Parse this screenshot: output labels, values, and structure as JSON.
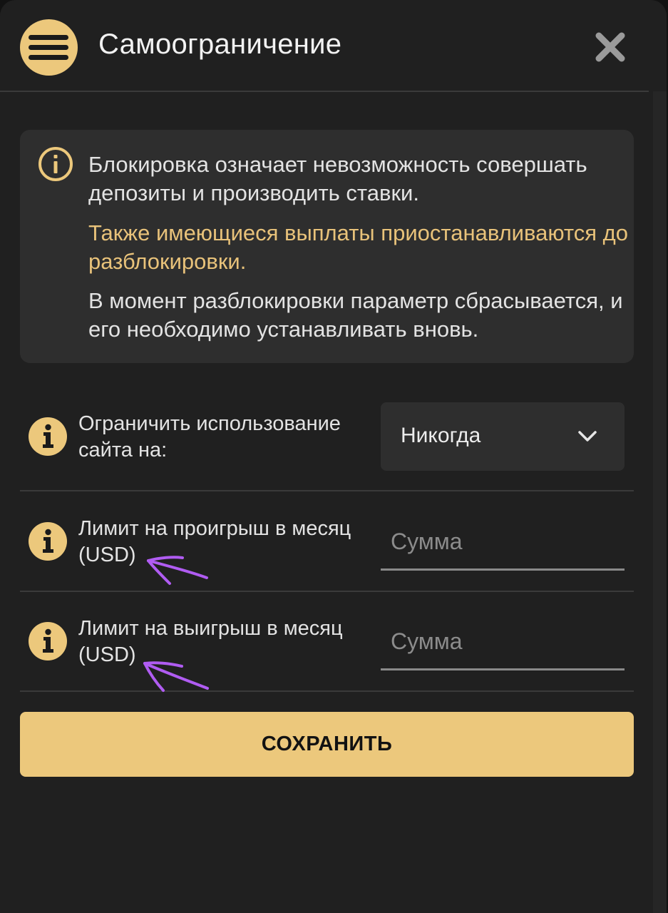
{
  "header": {
    "title": "Самоограничение",
    "menu_icon": "hamburger-icon",
    "close_icon": "close-icon"
  },
  "notice": {
    "icon": "info-circle-icon",
    "line1": "Блокировка означает невозможность совершать депозиты и производить ставки.",
    "line2": "Также имеющиеся выплаты приостанавливаются до разблокировки.",
    "line3": "В момент разблокировки параметр сбрасывается, и его необходимо устанавливать вновь."
  },
  "restrict": {
    "label": "Ограничить использование сайта на:",
    "selected": "Никогда"
  },
  "loss_limit": {
    "label": "Лимит на проигрыш в месяц (USD)",
    "placeholder": "Сумма"
  },
  "win_limit": {
    "label": "Лимит на выигрыш в месяц (USD)",
    "placeholder": "Сумма"
  },
  "save_button": {
    "label": "СОХРАНИТЬ"
  },
  "colors": {
    "accent": "#ecc87c",
    "background": "#202020",
    "card": "#2e2e2e",
    "warning_text": "#e8c27a",
    "annotation": "#b05cf2"
  }
}
